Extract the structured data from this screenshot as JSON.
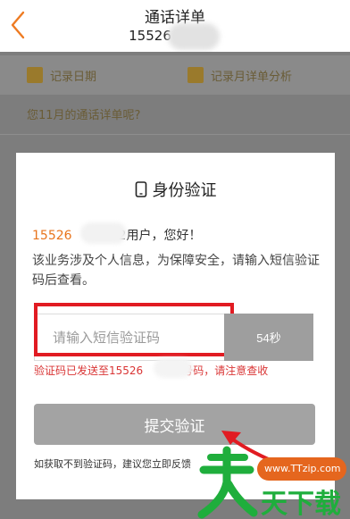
{
  "header": {
    "title": "通话详单",
    "number_visible": "15526"
  },
  "background": {
    "tab_left": "记录日期",
    "tab_right": "记录月详单分析",
    "link": "您11月的通话详单呢?"
  },
  "dialog": {
    "title": "身份验证",
    "phone_prefix": "15526",
    "phone_suffix": "2用户，您好！",
    "notice": "该业务涉及个人信息，为保障安全，请输入短信验证码后查看。",
    "input_placeholder": "请输入短信验证码",
    "countdown": "54秒",
    "sent_message": "验证码已发送至15526",
    "sent_suffix": "号码，请注意查收",
    "submit_label": "提交验证",
    "footnote": "如获取不到验证码，建议您立即反馈"
  },
  "watermark": {
    "url": "www.TTzip.com",
    "brand": "天下载"
  },
  "colors": {
    "accent_orange": "#e8741c",
    "error_red": "#d93434",
    "highlight_red": "#e11b22",
    "button_gray": "#a3a3a3"
  }
}
